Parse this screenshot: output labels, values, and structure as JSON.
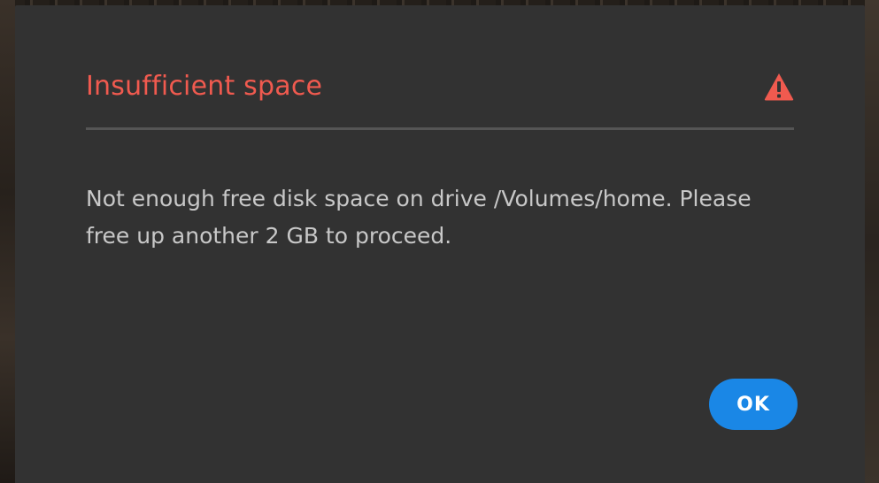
{
  "dialog": {
    "title": "Insufficient space",
    "icon": "alert-triangle-icon",
    "message": "Not enough free disk space on drive /Volumes/home. Please free up another 2 GB to proceed.",
    "ok_label": "OK"
  },
  "colors": {
    "title": "#f05a4f",
    "alert_icon": "#f05a4f",
    "dialog_background": "#323232",
    "primary_button": "#1a87e6"
  }
}
